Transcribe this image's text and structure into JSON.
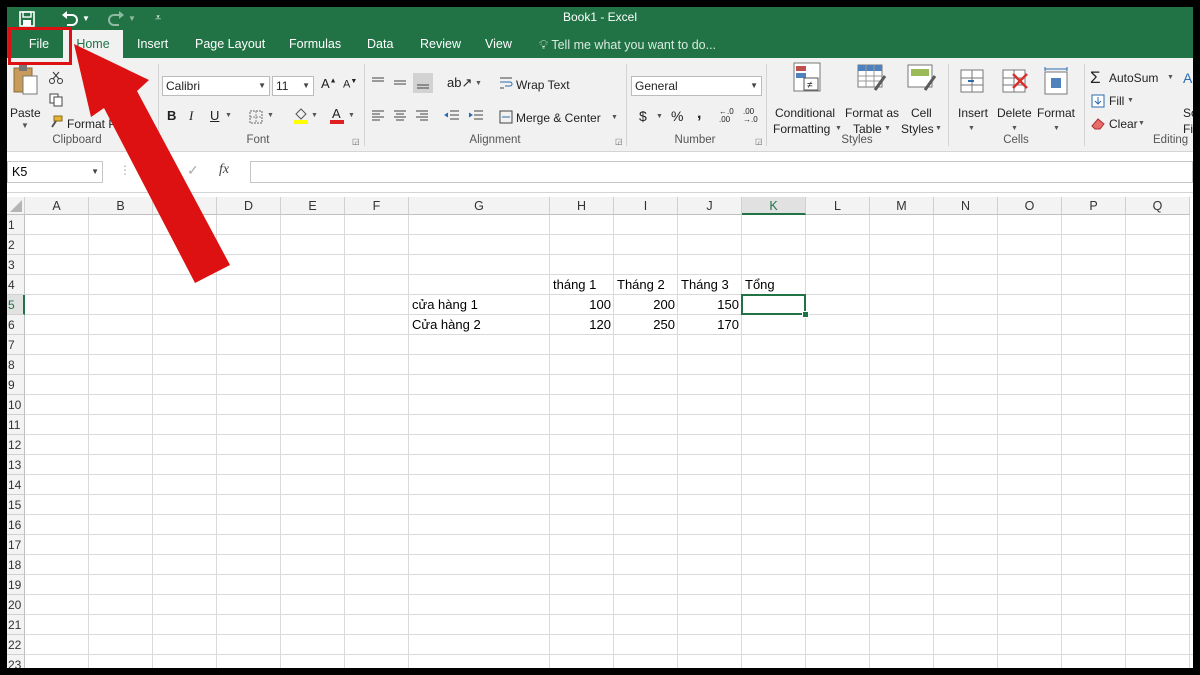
{
  "window": {
    "title": "Book1 - Excel"
  },
  "tabs": {
    "file": "File",
    "home": "Home",
    "insert": "Insert",
    "page_layout": "Page Layout",
    "formulas": "Formulas",
    "data": "Data",
    "review": "Review",
    "view": "View",
    "tell_me": "Tell me what you want to do..."
  },
  "ribbon": {
    "clipboard": {
      "paste": "Paste",
      "format_painter": "Format Painter",
      "label": "Clipboard"
    },
    "font": {
      "name": "Calibri",
      "size": "11",
      "bold": "B",
      "italic": "I",
      "underline": "U",
      "label": "Font"
    },
    "alignment": {
      "wrap_text": "Wrap Text",
      "merge_center": "Merge & Center",
      "label": "Alignment"
    },
    "number": {
      "format": "General",
      "currency": "$",
      "percent": "%",
      "comma": ",",
      "label": "Number"
    },
    "styles": {
      "conditional_1": "Conditional",
      "conditional_2": "Formatting",
      "format_table_1": "Format as",
      "format_table_2": "Table",
      "cell_styles_1": "Cell",
      "cell_styles_2": "Styles",
      "label": "Styles"
    },
    "cells": {
      "insert": "Insert",
      "delete": "Delete",
      "format": "Format",
      "label": "Cells"
    },
    "editing": {
      "autosum": "AutoSum",
      "fill": "Fill",
      "clear": "Clear",
      "label": "Editing",
      "sort_1": "So",
      "sort_2": "Fi"
    }
  },
  "formula_bar": {
    "name_box": "K5",
    "fx": "fx",
    "value": ""
  },
  "grid": {
    "columns": [
      "A",
      "B",
      "C",
      "D",
      "E",
      "F",
      "G",
      "H",
      "I",
      "J",
      "K",
      "L",
      "M",
      "N",
      "O",
      "P",
      "Q"
    ],
    "rows": [
      "1",
      "2",
      "3",
      "4",
      "5",
      "6",
      "7",
      "8",
      "9",
      "10",
      "11",
      "12",
      "13",
      "14",
      "15",
      "16",
      "17",
      "18",
      "19",
      "20",
      "21",
      "22",
      "23"
    ],
    "selected_cell": "K5",
    "cells": {
      "H4": "tháng 1",
      "I4": "Tháng 2",
      "J4": "Tháng 3",
      "K4": "Tổng",
      "G5": "cửa hàng 1",
      "H5": "100",
      "I5": "200",
      "J5": "150",
      "G6": "Cửa hàng 2",
      "H6": "120",
      "I6": "250",
      "J6": "170"
    }
  },
  "annotation": {
    "color": "#dd1111"
  }
}
